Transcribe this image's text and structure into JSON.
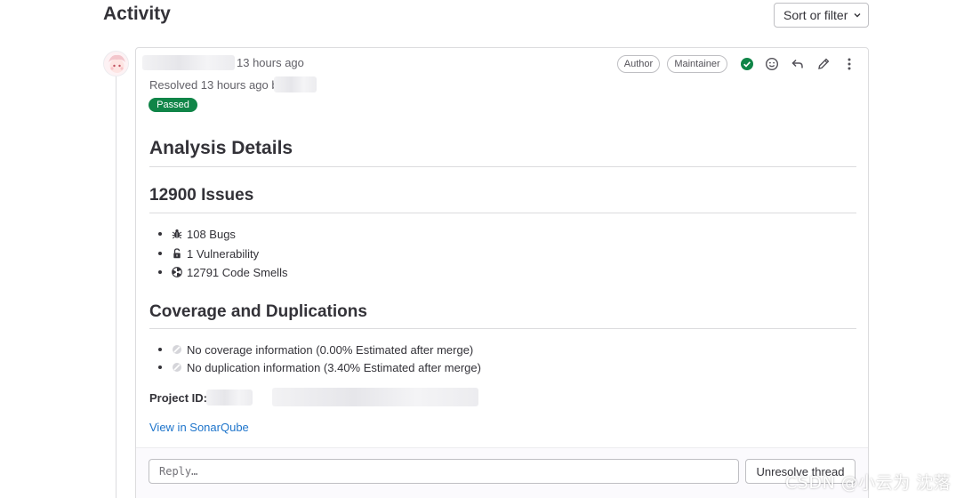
{
  "header": {
    "title": "Activity",
    "sort_label": "Sort or filter"
  },
  "note": {
    "time_ago": "13 hours ago",
    "resolved_text": "Resolved 13 hours ago b",
    "status_badge": "Passed",
    "roles": [
      "Author",
      "Maintainer"
    ],
    "actions": [
      "resolve-thread-icon",
      "emoji-icon",
      "reply-icon",
      "edit-icon",
      "more-actions-icon"
    ]
  },
  "content": {
    "heading": "Analysis Details",
    "issues_heading": "12900 Issues",
    "issues": [
      {
        "icon": "bug-icon",
        "text": "108 Bugs"
      },
      {
        "icon": "unlock-icon",
        "text": "1 Vulnerability"
      },
      {
        "icon": "code-smell-icon",
        "text": "12791 Code Smells"
      }
    ],
    "coverage_heading": "Coverage and Duplications",
    "coverage_items": [
      {
        "icon": "no-data-icon",
        "text": "No coverage information (0.00% Estimated after merge)"
      },
      {
        "icon": "no-data-icon",
        "text": "No duplication information (3.40% Estimated after merge)"
      }
    ],
    "project_id_label": "Project ID:",
    "sonar_link": "View in SonarQube"
  },
  "reply": {
    "placeholder": "Reply…",
    "unresolve_label": "Unresolve thread"
  },
  "watermark": "CSDN @小云为 沈落",
  "colors": {
    "passed": "#108548",
    "link": "#1f75cb",
    "resolved_check": "#108548"
  }
}
